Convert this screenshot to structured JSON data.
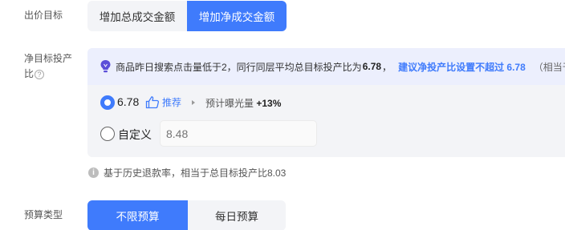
{
  "bid_target": {
    "label": "出价目标",
    "options": [
      {
        "label": "增加总成交金额",
        "selected": false
      },
      {
        "label": "增加净成交金额",
        "selected": true
      }
    ]
  },
  "net_roi": {
    "label_line1": "净目标投产",
    "label_line2": "比",
    "help_icon": "?",
    "notice": {
      "icon": "lightbulb-icon",
      "text_before": "商品昨日搜索点击量低于2，同行同层平均总目标投产比为",
      "value": "6.78",
      "text_after": "，",
      "link": "建议净投产比设置不超过 6.78",
      "tail": "（相当于总"
    },
    "recommended": {
      "value": "6.78",
      "badge": "推荐",
      "estimate_label": "预计曝光量",
      "estimate_value": "+13%",
      "selected": true
    },
    "custom": {
      "label": "自定义",
      "placeholder": "8.48",
      "selected": false
    },
    "hint": "基于历史退款率，相当于总目标投产比8.03"
  },
  "budget_type": {
    "label": "预算类型",
    "options": [
      {
        "label": "不限预算",
        "selected": true
      },
      {
        "label": "每日预算",
        "selected": false
      }
    ]
  },
  "colors": {
    "accent": "#3f7bfc",
    "notice_bg": "#eceffd",
    "panel_bg": "#f3f4f7"
  }
}
